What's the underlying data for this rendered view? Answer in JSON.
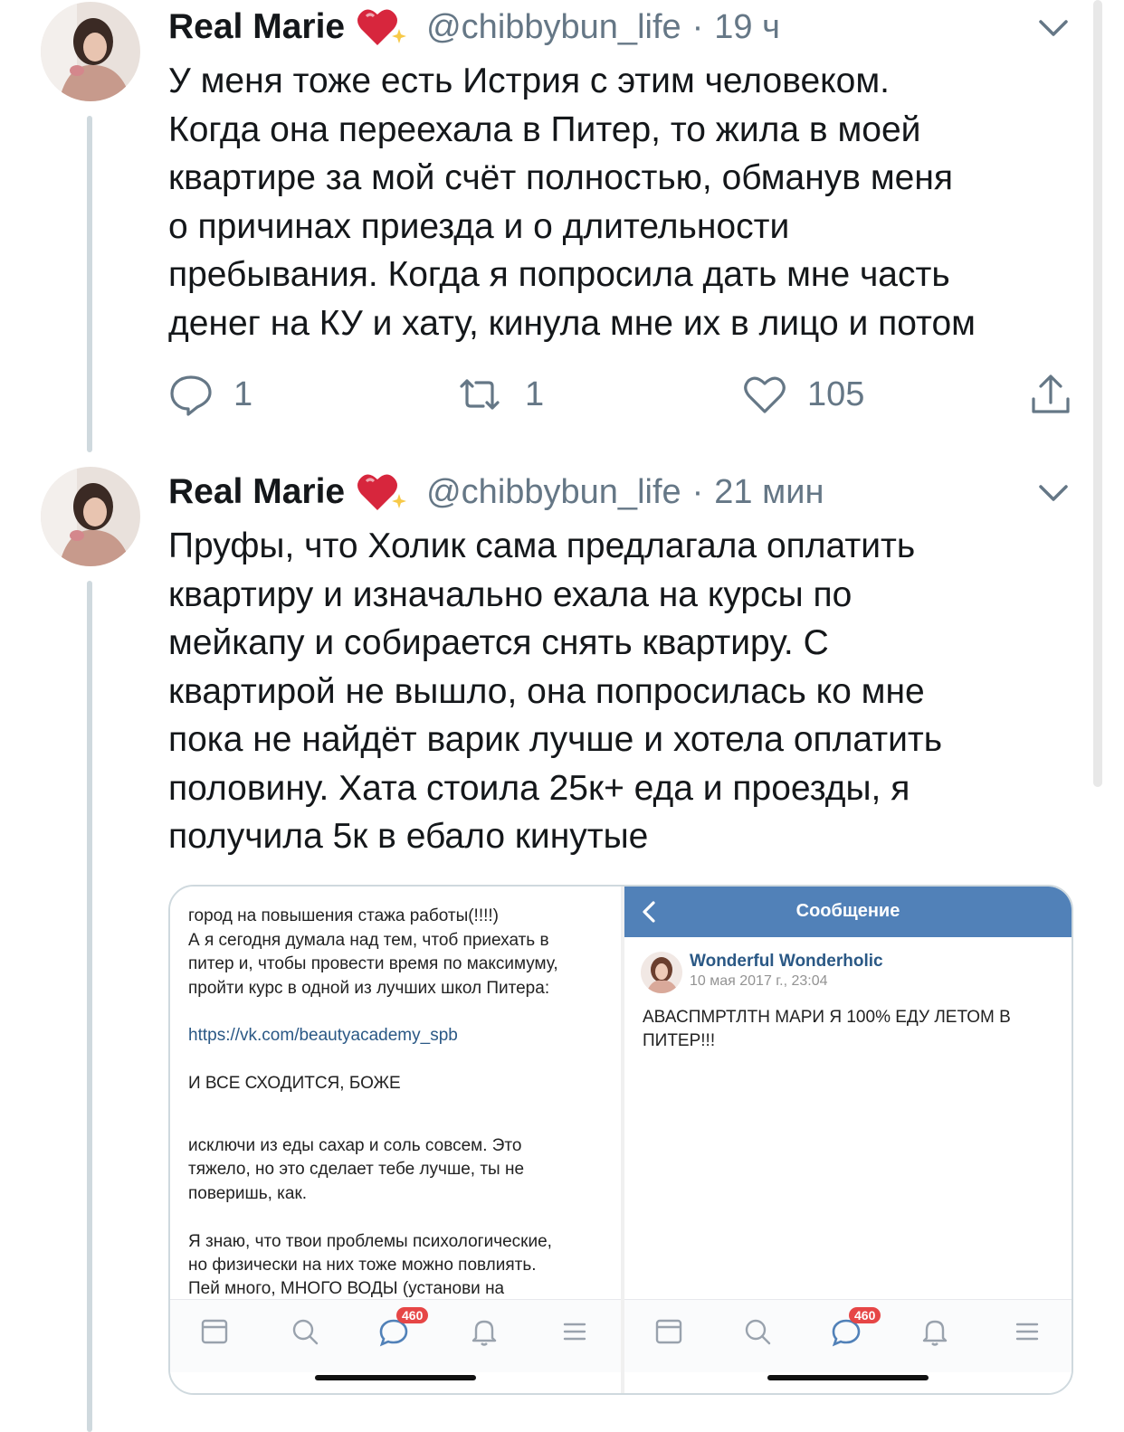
{
  "tweets": [
    {
      "display_name": "Real Marie",
      "handle": "@chibbybun_life",
      "separator": "·",
      "time": "19 ч",
      "text": "У меня тоже есть Истрия с этим человеком.\nКогда она переехала в Питер, то жила в моей\nквартире за мой счёт полностью, обманув меня\nо причинах приезда и о длительности\nпребывания. Когда я попросила дать мне часть\nденег на КУ и хату, кинула мне их в лицо и потом",
      "replies": "1",
      "retweets": "1",
      "likes": "105"
    },
    {
      "display_name": "Real Marie",
      "handle": "@chibbybun_life",
      "separator": "·",
      "time": "21 мин",
      "text": "Пруфы, что Холик сама предлагала оплатить\nквартиру и изначально ехала на курсы по\nмейкапу и собирается снять квартиру. С\nквартирой не вышло, она попросилась ко мне\nпока не найдёт варик лучше и хотела оплатить\nполовину. Хата стоила 25к+ еда и проезды, я\nполучила 5к в ебало кинутые"
    }
  ],
  "media": {
    "left": {
      "top_text": "город на повышения стажа работы(!!!!)\nА я сегодня думала над тем,  чтоб приехать в\nпитер и,  чтобы провести время по максимуму,\nпройти курс в одной из лучших школ Питера:",
      "link": "https://vk.com/beautyacademy_spb",
      "after_link": "И ВСЕ СХОДИТСЯ,  БОЖЕ",
      "bottom_text": "исключи из еды сахар и соль совсем.  Это\nтяжело,  но это сделает тебе лучше,  ты не\nповеришь,  как.\n\nЯ знаю,  что твои проблемы психологические,\nно физически на них тоже можно повлиять.\nПей много,  МНОГО ВОДЫ (установи на",
      "badge": "460"
    },
    "right": {
      "header_title": "Сообщение",
      "sender": "Wonderful Wonderholic",
      "date": "10 мая 2017 г., 23:04",
      "message": "АВАСПМРТЛТН МАРИ Я 100% ЕДУ ЛЕТОМ В\nПИТЕР!!!",
      "badge": "460"
    }
  },
  "colors": {
    "text": "#14171a",
    "secondary": "#657786",
    "vk_blue": "#5181b8",
    "vk_link": "#2a5885",
    "badge_red": "#e64646"
  },
  "icons": [
    "chevron-down-icon",
    "reply-icon",
    "retweet-icon",
    "like-icon",
    "share-icon",
    "sparkling-heart-icon",
    "back-arrow-icon",
    "feed-icon",
    "search-icon",
    "messages-icon",
    "notifications-icon",
    "menu-icon"
  ]
}
